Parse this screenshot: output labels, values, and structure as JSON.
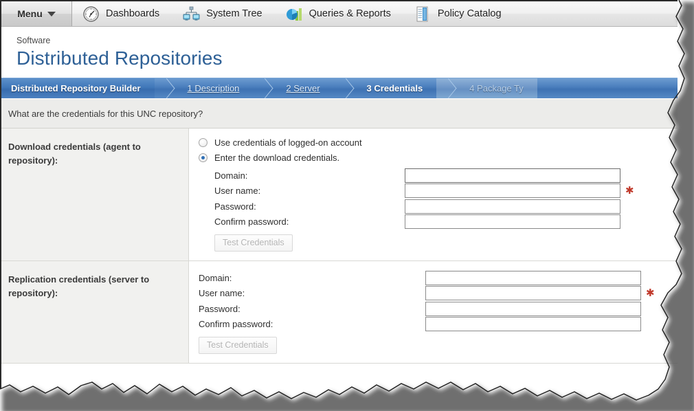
{
  "navbar": {
    "menu_label": "Menu",
    "menu_icon": "caret-down-icon",
    "items": [
      {
        "label": "Dashboards",
        "icon": "gauge-icon"
      },
      {
        "label": "System Tree",
        "icon": "network-tree-icon"
      },
      {
        "label": "Queries & Reports",
        "icon": "bar-chart-pie-icon"
      },
      {
        "label": "Policy Catalog",
        "icon": "document-list-icon"
      }
    ]
  },
  "header": {
    "breadcrumb": "Software",
    "title": "Distributed Repositories"
  },
  "wizard": {
    "title": "Distributed Repository Builder",
    "steps": [
      {
        "label": "1 Description",
        "state": "done"
      },
      {
        "label": "2 Server",
        "state": "done"
      },
      {
        "label": "3 Credentials",
        "state": "current"
      },
      {
        "label": "4 Package Ty",
        "state": "future"
      }
    ]
  },
  "instruction": "What are the credentials for this UNC repository?",
  "sections": [
    {
      "label": "Download credentials (agent to repository):",
      "radios": [
        {
          "label": "Use credentials of logged-on account",
          "checked": false
        },
        {
          "label": "Enter the download credentials.",
          "checked": true
        }
      ],
      "fields": [
        {
          "label": "Domain:",
          "value": "",
          "required": false,
          "focused": true,
          "type": "text"
        },
        {
          "label": "User name:",
          "value": "",
          "required": true,
          "focused": false,
          "type": "text"
        },
        {
          "label": "Password:",
          "value": "",
          "required": false,
          "focused": false,
          "type": "password"
        },
        {
          "label": "Confirm password:",
          "value": "",
          "required": false,
          "focused": false,
          "type": "password"
        }
      ],
      "button": {
        "label": "Test Credentials",
        "disabled": true
      }
    },
    {
      "label": "Replication credentials (server to repository):",
      "radios": [],
      "fields": [
        {
          "label": "Domain:",
          "value": "",
          "required": false,
          "focused": false,
          "type": "text"
        },
        {
          "label": "User name:",
          "value": "",
          "required": true,
          "focused": false,
          "type": "text"
        },
        {
          "label": "Password:",
          "value": "",
          "required": false,
          "focused": false,
          "type": "password"
        },
        {
          "label": "Confirm password:",
          "value": "",
          "required": false,
          "focused": false,
          "type": "password"
        }
      ],
      "button": {
        "label": "Test Credentials",
        "disabled": true
      }
    }
  ],
  "colors": {
    "accent_blue": "#2e6096",
    "wizard_blue": "#4b7fbe",
    "required_red": "#c0392b",
    "label_bg": "#f1f1ef",
    "instruction_bg": "#ececea"
  }
}
